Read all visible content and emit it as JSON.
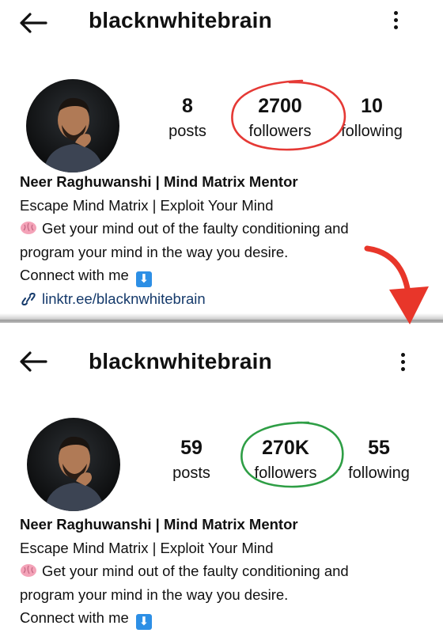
{
  "colors": {
    "red_mark": "#e53935",
    "green_mark": "#2e9e45",
    "link": "#153a6b",
    "badge": "#2d8fe5"
  },
  "top": {
    "username": "blacknwhitebrain",
    "stats": [
      {
        "value": "8",
        "label": "posts"
      },
      {
        "value": "2700",
        "label": "followers"
      },
      {
        "value": "10",
        "label": "following"
      }
    ],
    "bio": {
      "name": "Neer Raghuwanshi | Mind Matrix Mentor",
      "line1": "Escape Mind Matrix | Exploit Your Mind",
      "line2": "Get your mind out of the faulty conditioning and",
      "line3": "program your mind in the way you desire.",
      "line4": "Connect with me",
      "link": "linktr.ee/blacknwhitebrain"
    }
  },
  "bottom": {
    "username": "blacknwhitebrain",
    "stats": [
      {
        "value": "59",
        "label": "posts"
      },
      {
        "value": "270K",
        "label": "followers"
      },
      {
        "value": "55",
        "label": "following"
      }
    ],
    "bio": {
      "name": "Neer Raghuwanshi | Mind Matrix Mentor",
      "line1": "Escape Mind Matrix | Exploit Your Mind",
      "line2": "Get your mind out of the faulty conditioning and",
      "line3": "program your mind in the way you desire.",
      "line4": "Connect with me"
    }
  },
  "icons": {
    "back": "back-arrow-icon",
    "menu": "more-vertical-icon",
    "brain": "brain-emoji-icon",
    "down": "down-arrow-emoji-icon",
    "link": "link-icon"
  }
}
